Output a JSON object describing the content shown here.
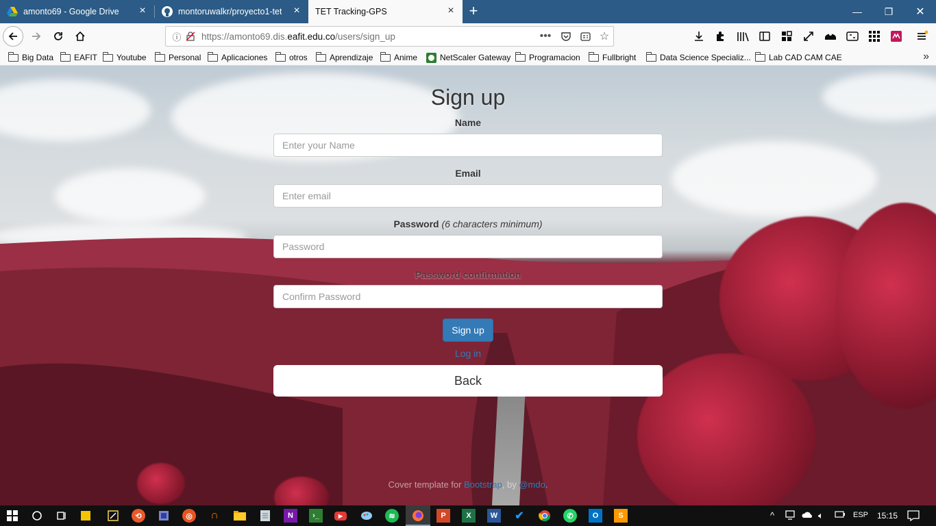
{
  "browser": {
    "tabs": [
      {
        "label": "amonto69 - Google Drive",
        "icon": "google-drive-icon",
        "active": false
      },
      {
        "label": "montoruwalkr/proyecto1-tet",
        "icon": "github-icon",
        "active": false
      },
      {
        "label": "TET Tracking-GPS",
        "icon": "none",
        "active": true
      }
    ],
    "url": {
      "prefix": "https://amonto69.dis.",
      "host": "eafit.edu.co",
      "path": "/users/sign_up"
    },
    "bookmarks": [
      {
        "label": "Big Data",
        "icon": "folder-icon"
      },
      {
        "label": "EAFIT",
        "icon": "folder-icon"
      },
      {
        "label": "Youtube",
        "icon": "folder-icon"
      },
      {
        "label": "Personal",
        "icon": "folder-icon"
      },
      {
        "label": "Aplicaciones",
        "icon": "folder-icon"
      },
      {
        "label": "otros",
        "icon": "folder-icon"
      },
      {
        "label": "Aprendizaje",
        "icon": "folder-icon"
      },
      {
        "label": "Anime",
        "icon": "folder-icon"
      },
      {
        "label": "NetScaler Gateway",
        "icon": "netscaler-icon"
      },
      {
        "label": "Programacion",
        "icon": "folder-icon"
      },
      {
        "label": "Fullbright",
        "icon": "folder-icon"
      },
      {
        "label": "Data Science Specializ...",
        "icon": "folder-icon"
      },
      {
        "label": "Lab CAD CAM CAE",
        "icon": "folder-icon"
      }
    ]
  },
  "page": {
    "title": "Sign up",
    "name_label": "Name",
    "name_placeholder": "Enter your Name",
    "email_label": "Email",
    "email_placeholder": "Enter email",
    "password_label": "Password",
    "password_hint": "(6 characters minimum)",
    "password_placeholder": "Password",
    "confirm_label": "Password confirmation",
    "confirm_placeholder": "Confirm Password",
    "submit_label": "Sign up",
    "login_label": "Log in",
    "back_label": "Back",
    "footer": {
      "prefix": "Cover template for ",
      "bootstrap": "Bootstrap",
      "by": ", by ",
      "author": "@mdo",
      "suffix": "."
    }
  },
  "taskbar": {
    "language": "ESP",
    "time": "15:15"
  },
  "colors": {
    "titlebar": "#2b5b86",
    "primary": "#337ab7",
    "taskbar": "#101010"
  }
}
